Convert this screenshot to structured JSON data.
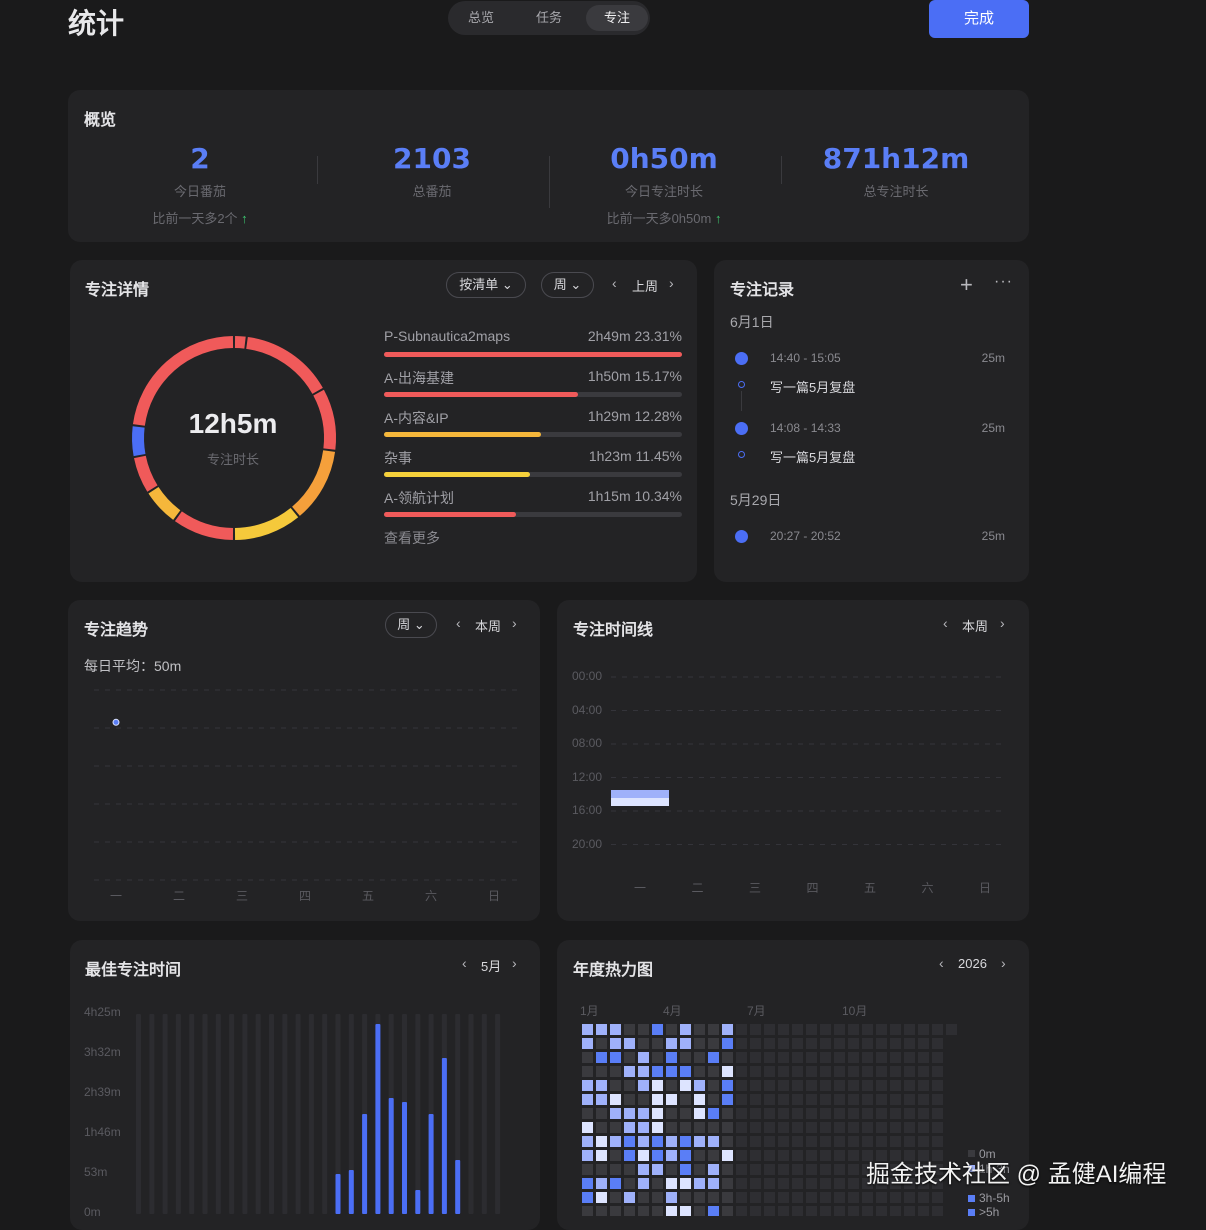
{
  "header": {
    "title": "统计",
    "tabs": [
      {
        "label": "总览",
        "active": false
      },
      {
        "label": "任务",
        "active": false
      },
      {
        "label": "专注",
        "active": true
      }
    ],
    "done_label": "完成"
  },
  "overview": {
    "title": "概览",
    "stats": [
      {
        "value": "2",
        "label": "今日番茄",
        "compare": "比前一天多2个"
      },
      {
        "value": "2103",
        "label": "总番茄",
        "compare": ""
      },
      {
        "value": "0h50m",
        "label": "今日专注时长",
        "compare": "比前一天多0h50m"
      },
      {
        "value": "871h12m",
        "label": "总专注时长",
        "compare": ""
      }
    ],
    "up_icon": "arrow-up-icon"
  },
  "focus_detail": {
    "title": "专注详情",
    "filter_label": "按清单",
    "period_label": "周",
    "range_label": "上周",
    "total_value": "12h5m",
    "total_label": "专注时长",
    "more_label": "查看更多",
    "tasks": [
      {
        "name": "P-Subnautica2maps",
        "value": "2h49m 23.31%",
        "ratio": 1.0,
        "color": "#f05a5a"
      },
      {
        "name": "A-出海基建",
        "value": "1h50m 15.17%",
        "ratio": 0.65,
        "color": "#f05a5a"
      },
      {
        "name": "A-内容&IP",
        "value": "1h29m 12.28%",
        "ratio": 0.527,
        "color": "#f5b73b"
      },
      {
        "name": "杂事",
        "value": "1h23m 11.45%",
        "ratio": 0.49,
        "color": "#f5d03b"
      },
      {
        "name": "A-领航计划",
        "value": "1h15m 10.34%",
        "ratio": 0.443,
        "color": "#f05a5a"
      }
    ],
    "ring_segments": [
      {
        "frac": 0.02,
        "color": "#f05a5a"
      },
      {
        "frac": 0.15,
        "color": "#f05a5a"
      },
      {
        "frac": 0.1,
        "color": "#f05a5a"
      },
      {
        "frac": 0.12,
        "color": "#f5a03b"
      },
      {
        "frac": 0.11,
        "color": "#f5c93b"
      },
      {
        "frac": 0.1,
        "color": "#f05a5a"
      },
      {
        "frac": 0.06,
        "color": "#f5b73b"
      },
      {
        "frac": 0.06,
        "color": "#f05a5a"
      },
      {
        "frac": 0.05,
        "color": "#4b6ef5"
      },
      {
        "frac": 0.23,
        "color": "#f05a5a"
      }
    ]
  },
  "records": {
    "title": "专注记录",
    "add_icon": "plus-icon",
    "more_icon": "more-icon",
    "groups": [
      {
        "date": "6月1日",
        "items": [
          {
            "time": "14:40 - 15:05",
            "duration": "25m",
            "note": "写一篇5月复盘"
          },
          {
            "time": "14:08 - 14:33",
            "duration": "25m",
            "note": "写一篇5月复盘"
          }
        ]
      },
      {
        "date": "5月29日",
        "items": [
          {
            "time": "20:27 - 20:52",
            "duration": "25m",
            "note": ""
          }
        ]
      }
    ]
  },
  "trend": {
    "title": "专注趋势",
    "period_label": "周",
    "range_label": "本周",
    "avg_label": "每日平均：50m",
    "weekdays": [
      "一",
      "二",
      "三",
      "四",
      "五",
      "六",
      "日"
    ],
    "points": [
      0.83
    ]
  },
  "timeline": {
    "title": "专注时间线",
    "range_label": "本周",
    "hours": [
      "00:00",
      "04:00",
      "08:00",
      "12:00",
      "16:00",
      "20:00"
    ],
    "weekdays": [
      "一",
      "二",
      "三",
      "四",
      "五",
      "六",
      "日"
    ]
  },
  "best_time": {
    "title": "最佳专注时间",
    "range_label": "5月",
    "y_labels": [
      "4h25m",
      "3h32m",
      "2h39m",
      "1h46m",
      "53m",
      "0m"
    ],
    "values": [
      0,
      0,
      0,
      0,
      0,
      0,
      0,
      0,
      0,
      0,
      0,
      0,
      0,
      0,
      0,
      0.2,
      0.22,
      0.5,
      0.95,
      0.58,
      0.56,
      0.12,
      0.5,
      0.78,
      0.27,
      0,
      0,
      0
    ]
  },
  "heatmap": {
    "title": "年度热力图",
    "range_label": "2026",
    "months": [
      "1月",
      "4月",
      "7月",
      "10月"
    ],
    "legend": [
      "0m",
      "1h-3h",
      "3h-5h",
      ">5h"
    ],
    "colors": [
      "#3a3a3e",
      "#9fb1fa",
      "#5a7ef6",
      "#dde4ff"
    ]
  },
  "watermark": "掘金技术社区 @ 孟健AI编程"
}
